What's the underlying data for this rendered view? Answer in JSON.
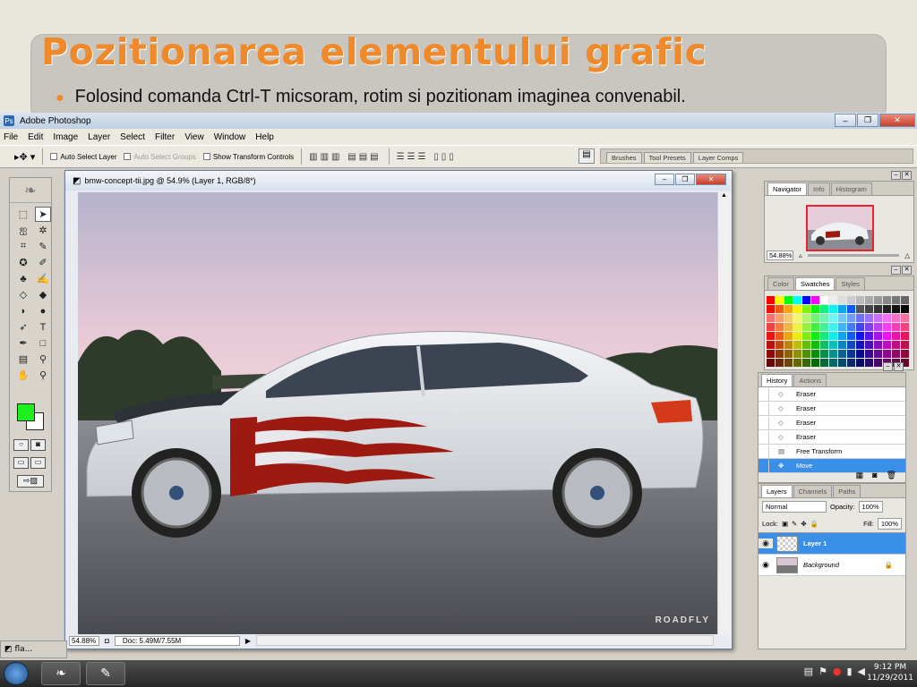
{
  "slide": {
    "title": "Pozitionarea elementului grafic",
    "bullet": "Folosind comanda Ctrl-T micsoram, rotim si pozitionam imaginea convenabil."
  },
  "app": {
    "title": "Adobe Photoshop",
    "menu": [
      "File",
      "Edit",
      "Image",
      "Layer",
      "Select",
      "Filter",
      "View",
      "Window",
      "Help"
    ],
    "options": {
      "auto_select_layer": "Auto Select Layer",
      "auto_select_groups": "Auto Select Groups",
      "show_transform_controls": "Show Transform Controls"
    },
    "palette_well_tabs": [
      "Brushes",
      "Tool Presets",
      "Layer Comps"
    ]
  },
  "colors": {
    "foreground": "#1ef01e",
    "background": "#ffffff",
    "accent": "#ef8a2c",
    "selection": "#3a8fe8",
    "flame": "#9c1a10"
  },
  "document": {
    "title": "bmw-concept-tii.jpg @ 54.9% (Layer 1, RGB/8*)",
    "zoom": "54.88%",
    "doc_size": "Doc: 5.49M/7.55M",
    "watermark": "ROADFLY"
  },
  "navigator": {
    "tabs": [
      "Navigator",
      "Info",
      "Histogram"
    ],
    "zoom": "54.88%"
  },
  "swatches_panel": {
    "tabs": [
      "Color",
      "Swatches",
      "Styles"
    ]
  },
  "history": {
    "tabs": [
      "History",
      "Actions"
    ],
    "items": [
      "Eraser",
      "Eraser",
      "Eraser",
      "Eraser",
      "Free Transform",
      "Move"
    ]
  },
  "layers": {
    "tabs": [
      "Layers",
      "Channels",
      "Paths"
    ],
    "blend_mode": "Normal",
    "opacity_label": "Opacity:",
    "opacity": "100%",
    "lock_label": "Lock:",
    "fill_label": "Fill:",
    "fill": "100%",
    "items": [
      "Layer 1",
      "Background"
    ]
  },
  "taskbar": {
    "doc_tab": "fla...",
    "time": "9:12 PM",
    "date": "11/29/2011"
  }
}
